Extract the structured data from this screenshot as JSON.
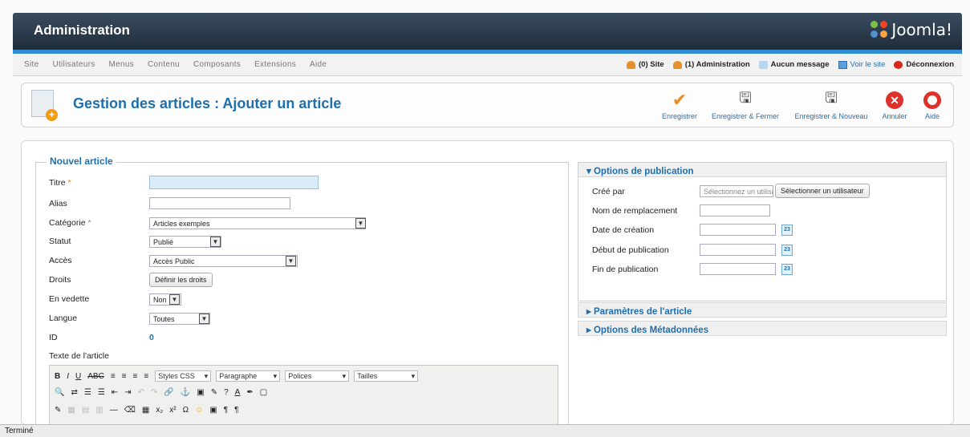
{
  "header": {
    "title": "Administration",
    "logo_text": "Joomla!"
  },
  "menu": [
    "Site",
    "Utilisateurs",
    "Menus",
    "Contenu",
    "Composants",
    "Extensions",
    "Aide"
  ],
  "status": {
    "site": "(0) Site",
    "admin": "(1) Administration",
    "messages": "Aucun message",
    "view_site": "Voir le site",
    "logout": "Déconnexion"
  },
  "page": {
    "title": "Gestion des articles : Ajouter un article"
  },
  "toolbar": {
    "save": "Enregistrer",
    "save_close": "Enregistrer & Fermer",
    "save_new": "Enregistrer & Nouveau",
    "cancel": "Annuler",
    "help": "Aide"
  },
  "form": {
    "legend": "Nouvel article",
    "title_label": "Titre",
    "alias_label": "Alias",
    "category_label": "Catégorie",
    "category_value": "Articles exemples",
    "status_label": "Statut",
    "status_value": "Publié",
    "access_label": "Accès",
    "access_value": "Accès Public",
    "rights_label": "Droits",
    "rights_button": "Définir les droits",
    "featured_label": "En vedette",
    "featured_value": "Non",
    "language_label": "Langue",
    "language_value": "Toutes",
    "id_label": "ID",
    "id_value": "0",
    "text_label": "Texte de l'article"
  },
  "editor": {
    "styles": "Styles CSS",
    "paragraph": "Paragraphe",
    "fonts": "Polices",
    "sizes": "Tailles"
  },
  "publishing": {
    "header": "Options de publication",
    "created_by_label": "Créé par",
    "created_by_placeholder": "Sélectionnez un utilisateur",
    "select_user_button": "Sélectionner un utilisateur",
    "alias_name_label": "Nom de remplacement",
    "created_date_label": "Date de création",
    "publish_up_label": "Début de publication",
    "publish_down_label": "Fin de publication",
    "calendar_day": "23"
  },
  "panels": {
    "article_params": "Paramètres de l'article",
    "metadata": "Options des Métadonnées"
  },
  "statusbar": "Terminé"
}
